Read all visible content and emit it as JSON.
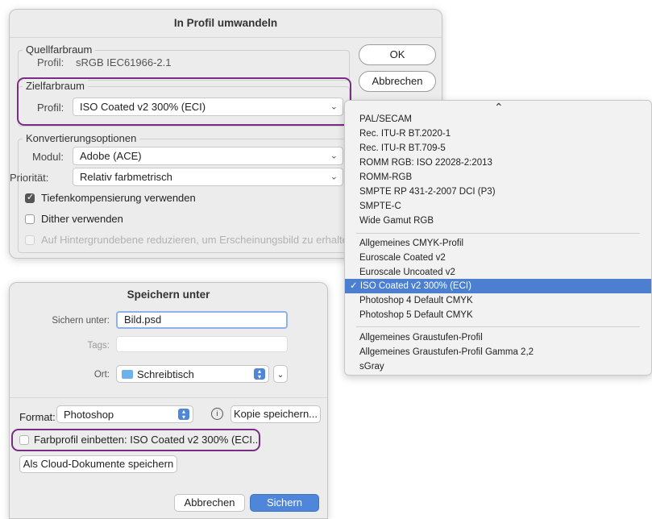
{
  "profile_dialog": {
    "title": "In Profil umwandeln",
    "source": {
      "legend": "Quellfarbraum",
      "label": "Profil:",
      "value": "sRGB IEC61966-2.1"
    },
    "target": {
      "legend": "Zielfarbraum",
      "label": "Profil:",
      "value": "ISO Coated v2 300% (ECI)"
    },
    "options": {
      "legend": "Konvertierungsoptionen",
      "engine_label": "Modul:",
      "engine_value": "Adobe (ACE)",
      "intent_label": "Priorität:",
      "intent_value": "Relativ farbmetrisch",
      "bpc_label": "Tiefenkompensierung verwenden",
      "dither_label": "Dither verwenden",
      "flatten_label": "Auf Hintergrundebene reduzieren, um Erscheinungsbild zu erhalten"
    },
    "ok_label": "OK",
    "cancel_label": "Abbrechen"
  },
  "profile_menu": {
    "scroll_up": "⌃",
    "group1": [
      "PAL/SECAM",
      "Rec. ITU-R BT.2020-1",
      "Rec. ITU-R BT.709-5",
      "ROMM RGB: ISO 22028-2:2013",
      "ROMM-RGB",
      "SMPTE RP 431-2-2007 DCI (P3)",
      "SMPTE-C",
      "Wide Gamut RGB"
    ],
    "group2": [
      "Allgemeines CMYK-Profil",
      "Euroscale Coated v2",
      "Euroscale Uncoated v2",
      "✓ ISO Coated v2 300% (ECI)",
      "Photoshop 4 Default CMYK",
      "Photoshop 5 Default CMYK"
    ],
    "group3": [
      "Allgemeines Graustufen-Profil",
      "Allgemeines Graustufen-Profil Gamma 2,2",
      "sGray"
    ]
  },
  "save_dialog": {
    "title": "Speichern unter",
    "save_as_label": "Sichern unter:",
    "save_as_value": "Bild.psd",
    "tags_label": "Tags:",
    "location_label": "Ort:",
    "location_value": "Schreibtisch",
    "format_label": "Format:",
    "format_value": "Photoshop",
    "save_copy_label": "Kopie speichern...",
    "embed_profile_label": "Farbprofil einbetten: ISO Coated v2 300% (ECI...",
    "cloud_label": "Als Cloud-Dokumente speichern",
    "cancel_label": "Abbrechen",
    "save_label": "Sichern"
  },
  "colors": {
    "accent": "#4c7fcf",
    "highlight": "#7a2d85",
    "primary_button": "#4f86d9"
  }
}
